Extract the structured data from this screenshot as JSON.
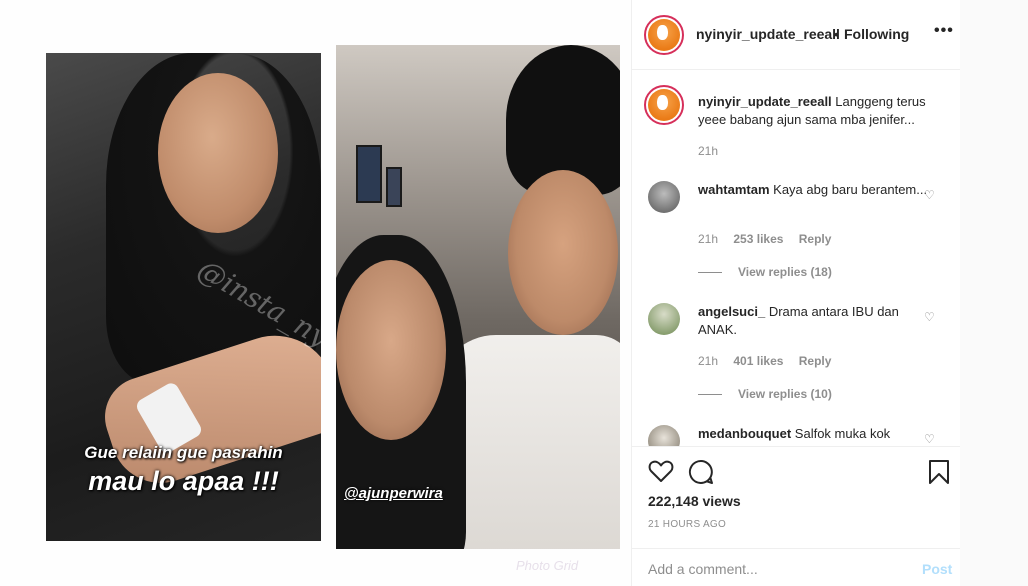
{
  "post": {
    "username": "nyinyir_update_reeall",
    "separator": "•",
    "follow_status": "Following",
    "more_icon": "more-options-icon",
    "caption_username": "nyinyir_update_reeall",
    "caption_text": "Langgeng terus yeee babang ajun sama mba jenifer...",
    "caption_time": "21h"
  },
  "media": {
    "overlay_line1": "Gue relaiin gue pasrahin",
    "overlay_line2": "mau lo apaa !!!",
    "watermark_left": "@insta_nyinyir",
    "handle_tag": "@ajunperwira",
    "corner_watermark": "Photo Grid"
  },
  "comments": [
    {
      "username": "wahtamtam",
      "text": "Kaya abg baru berantem...",
      "time": "21h",
      "likes": "253 likes",
      "reply": "Reply",
      "view_replies": "View replies (18)"
    },
    {
      "username": "angelsuci_",
      "text": "Drama antara IBU dan ANAK.",
      "time": "21h",
      "likes": "401 likes",
      "reply": "Reply",
      "view_replies": "View replies (10)"
    },
    {
      "username": "medanbouquet",
      "text": "Salfok muka kok"
    }
  ],
  "actions": {
    "like_icon": "heart-icon",
    "comment_icon": "comment-bubble-icon",
    "save_icon": "bookmark-icon",
    "views": "222,148 views",
    "timestamp": "21 HOURS AGO"
  },
  "add_comment": {
    "placeholder": "Add a comment...",
    "post_label": "Post"
  },
  "colors": {
    "story_ring": "#d62f5a",
    "post_button_disabled": "#b2dffc",
    "muted_text": "#8e8e8e"
  }
}
